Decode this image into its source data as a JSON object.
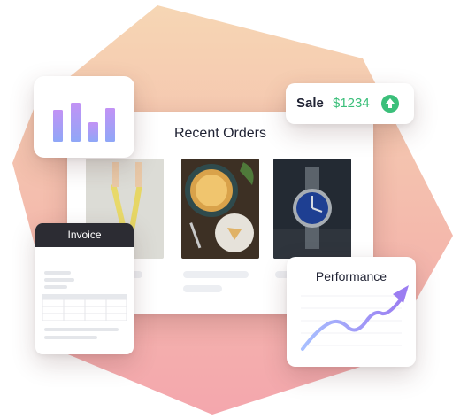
{
  "orders": {
    "title": "Recent Orders",
    "products": [
      {
        "name": "shoes-photo"
      },
      {
        "name": "pie-photo"
      },
      {
        "name": "watch-photo"
      }
    ]
  },
  "sale": {
    "label": "Sale",
    "amount": "$1234",
    "icon": "arrow-up-icon",
    "accent": "#3bbf7a"
  },
  "invoice": {
    "title": "Invoice"
  },
  "performance": {
    "title": "Performance"
  },
  "colors": {
    "blob_top": "#f4c7a8",
    "blob_bottom": "#f2a3a6",
    "chart_bar": "#9f8ef5",
    "trend_start": "#9fb6ff",
    "trend_end": "#9b7df1"
  }
}
